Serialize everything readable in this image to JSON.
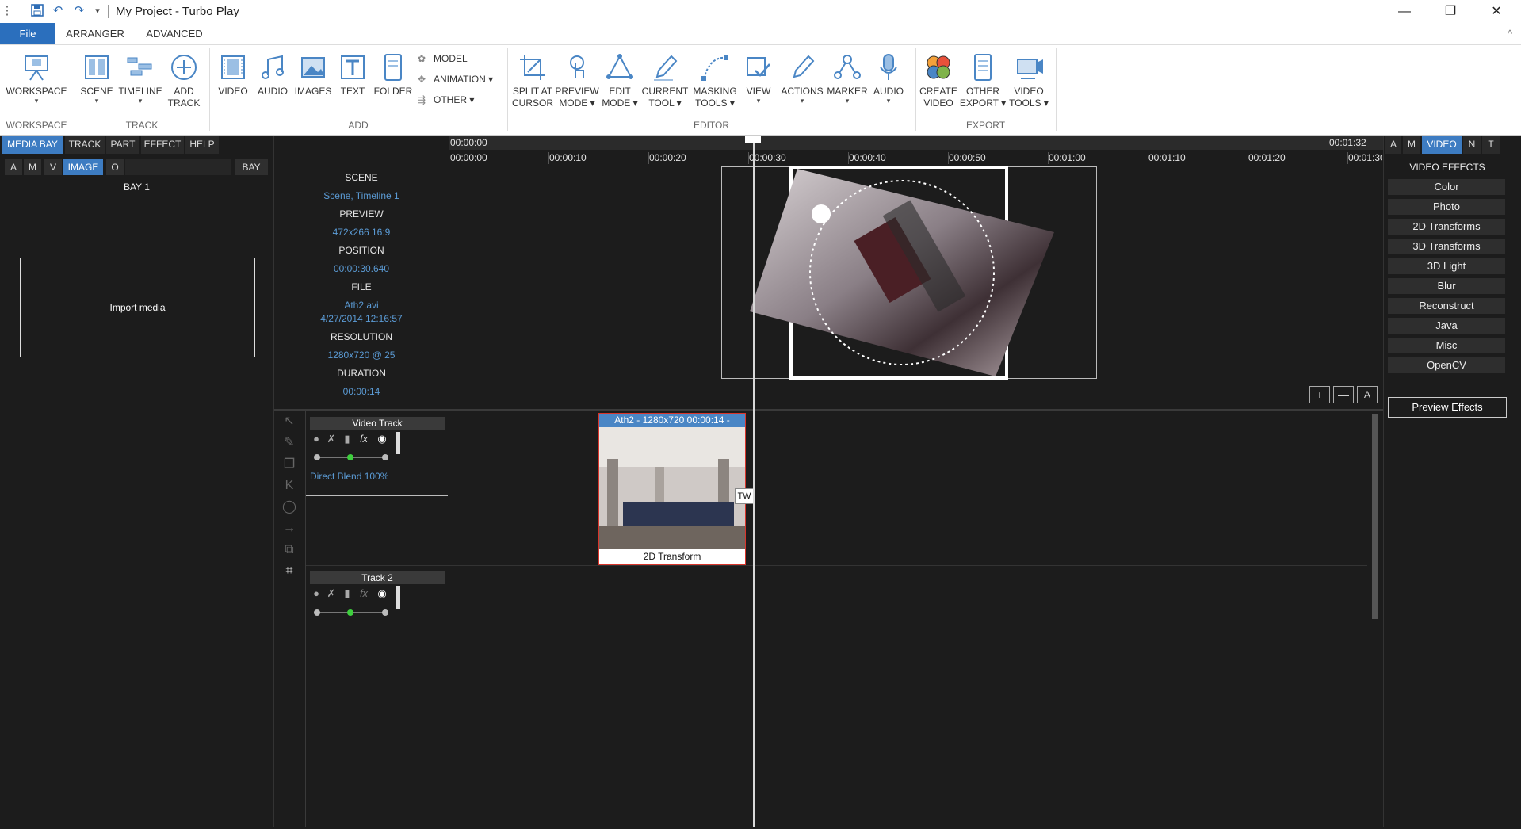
{
  "window": {
    "title": "My Project - Turbo Play",
    "controls": {
      "minimize": "—",
      "maximize": "❐",
      "close": "✕"
    }
  },
  "quick_access": {
    "app_icon": "app-icon",
    "save": "save-icon",
    "undo": "undo-icon",
    "redo": "redo-icon",
    "customize": "▾"
  },
  "menu_tabs": [
    {
      "label": "File",
      "selected": true
    },
    {
      "label": "ARRANGER",
      "selected": false
    },
    {
      "label": "ADVANCED",
      "selected": false
    }
  ],
  "ribbon": {
    "groups": [
      "WORKSPACE",
      "TRACK",
      "ADD",
      "EDITOR",
      "EXPORT"
    ],
    "workspace": {
      "label": "WORKSPACE",
      "dropdown": "▾"
    },
    "track_buttons": [
      {
        "label": "SCENE",
        "dropdown": "▾"
      },
      {
        "label": "TIMELINE",
        "dropdown": "▾"
      },
      {
        "label": "ADD\nTRACK",
        "dropdown": ""
      }
    ],
    "add_buttons": [
      {
        "label": "VIDEO"
      },
      {
        "label": "AUDIO"
      },
      {
        "label": "IMAGES"
      },
      {
        "label": "TEXT"
      },
      {
        "label": "FOLDER"
      }
    ],
    "add_small": [
      {
        "label": "MODEL"
      },
      {
        "label": "ANIMATION ▾"
      },
      {
        "label": "OTHER ▾"
      }
    ],
    "editor_buttons": [
      {
        "label": "SPLIT AT\nCURSOR",
        "dropdown": ""
      },
      {
        "label": "PREVIEW\nMODE ▾",
        "dropdown": ""
      },
      {
        "label": "EDIT\nMODE ▾",
        "dropdown": ""
      },
      {
        "label": "CURRENT\nTOOL ▾",
        "dropdown": ""
      },
      {
        "label": "MASKING\nTOOLS ▾",
        "dropdown": ""
      },
      {
        "label": "VIEW",
        "dropdown": "▾"
      },
      {
        "label": "ACTIONS",
        "dropdown": "▾"
      },
      {
        "label": "MARKER",
        "dropdown": "▾"
      },
      {
        "label": "AUDIO",
        "dropdown": "▾"
      }
    ],
    "export_buttons": [
      {
        "label": "CREATE\nVIDEO",
        "dropdown": ""
      },
      {
        "label": "OTHER\nEXPORT ▾",
        "dropdown": ""
      },
      {
        "label": "VIDEO\nTOOLS ▾",
        "dropdown": ""
      }
    ],
    "collapse": "^"
  },
  "left_panel": {
    "tabs": [
      {
        "label": "MEDIA BAY",
        "selected": true
      },
      {
        "label": "TRACK",
        "selected": false
      },
      {
        "label": "PART",
        "selected": false
      },
      {
        "label": "EFFECT",
        "selected": false
      },
      {
        "label": "HELP",
        "selected": false
      }
    ],
    "filter_tabs": [
      {
        "label": "A",
        "selected": false
      },
      {
        "label": "M",
        "selected": false
      },
      {
        "label": "V",
        "selected": false
      },
      {
        "label": "IMAGE",
        "selected": true
      },
      {
        "label": "O",
        "selected": false
      }
    ],
    "bay_button": "BAY",
    "bay_title": "BAY 1",
    "import_media": "Import media"
  },
  "info_panel": {
    "scene_label": "SCENE",
    "scene_value": "Scene, Timeline 1",
    "preview_label": "PREVIEW",
    "preview_value": "472x266 16:9",
    "position_label": "POSITION",
    "position_value": "00:00:30.640",
    "file_label": "FILE",
    "file_name": "Ath2.avi",
    "file_date": "4/27/2014 12:16:57",
    "resolution_label": "RESOLUTION",
    "resolution_value": "1280x720 @ 25",
    "duration_label": "DURATION",
    "duration_value": "00:00:14"
  },
  "timeline": {
    "start_time": "00:00:00",
    "end_time": "00:01:32",
    "ticks": [
      "00:00:00",
      "00:00:10",
      "00:00:20",
      "00:00:30",
      "00:00:40",
      "00:00:50",
      "00:01:00",
      "00:01:10",
      "00:01:20",
      "00:01:30"
    ],
    "cursor_time": "00:00:30.640",
    "zoom_buttons": [
      "+",
      "—",
      "A"
    ]
  },
  "tools": [
    "pointer-icon",
    "clip-icon",
    "copy-icon",
    "trim-icon",
    "loop-icon",
    "arrow-icon",
    "duplicate-icon",
    "transform-icon"
  ],
  "tracks": [
    {
      "name": "Video Track",
      "blend": "Direct Blend 100%",
      "clip": {
        "title": "Ath2 - 1280x720 00:00:14 -",
        "effect": "2D Transform",
        "badge": "TW"
      }
    },
    {
      "name": "Track 2",
      "blend": "",
      "clip": null
    }
  ],
  "right_panel": {
    "tabs": [
      {
        "label": "A",
        "selected": false
      },
      {
        "label": "M",
        "selected": false
      },
      {
        "label": "VIDEO",
        "selected": true
      },
      {
        "label": "N",
        "selected": false
      },
      {
        "label": "T",
        "selected": false
      }
    ],
    "heading": "VIDEO EFFECTS",
    "effects": [
      "Color",
      "Photo",
      "2D Transforms",
      "3D Transforms",
      "3D Light",
      "Blur",
      "Reconstruct",
      "Java",
      "Misc",
      "OpenCV"
    ],
    "preview_button": "Preview Effects"
  },
  "colors": {
    "accent": "#3d7cc2",
    "file_tab": "#2b6fbd",
    "value_blue": "#5b9bd5",
    "clip_header": "#4a86c5",
    "clip_border": "#d9352b",
    "background": "#1c1c1c"
  }
}
